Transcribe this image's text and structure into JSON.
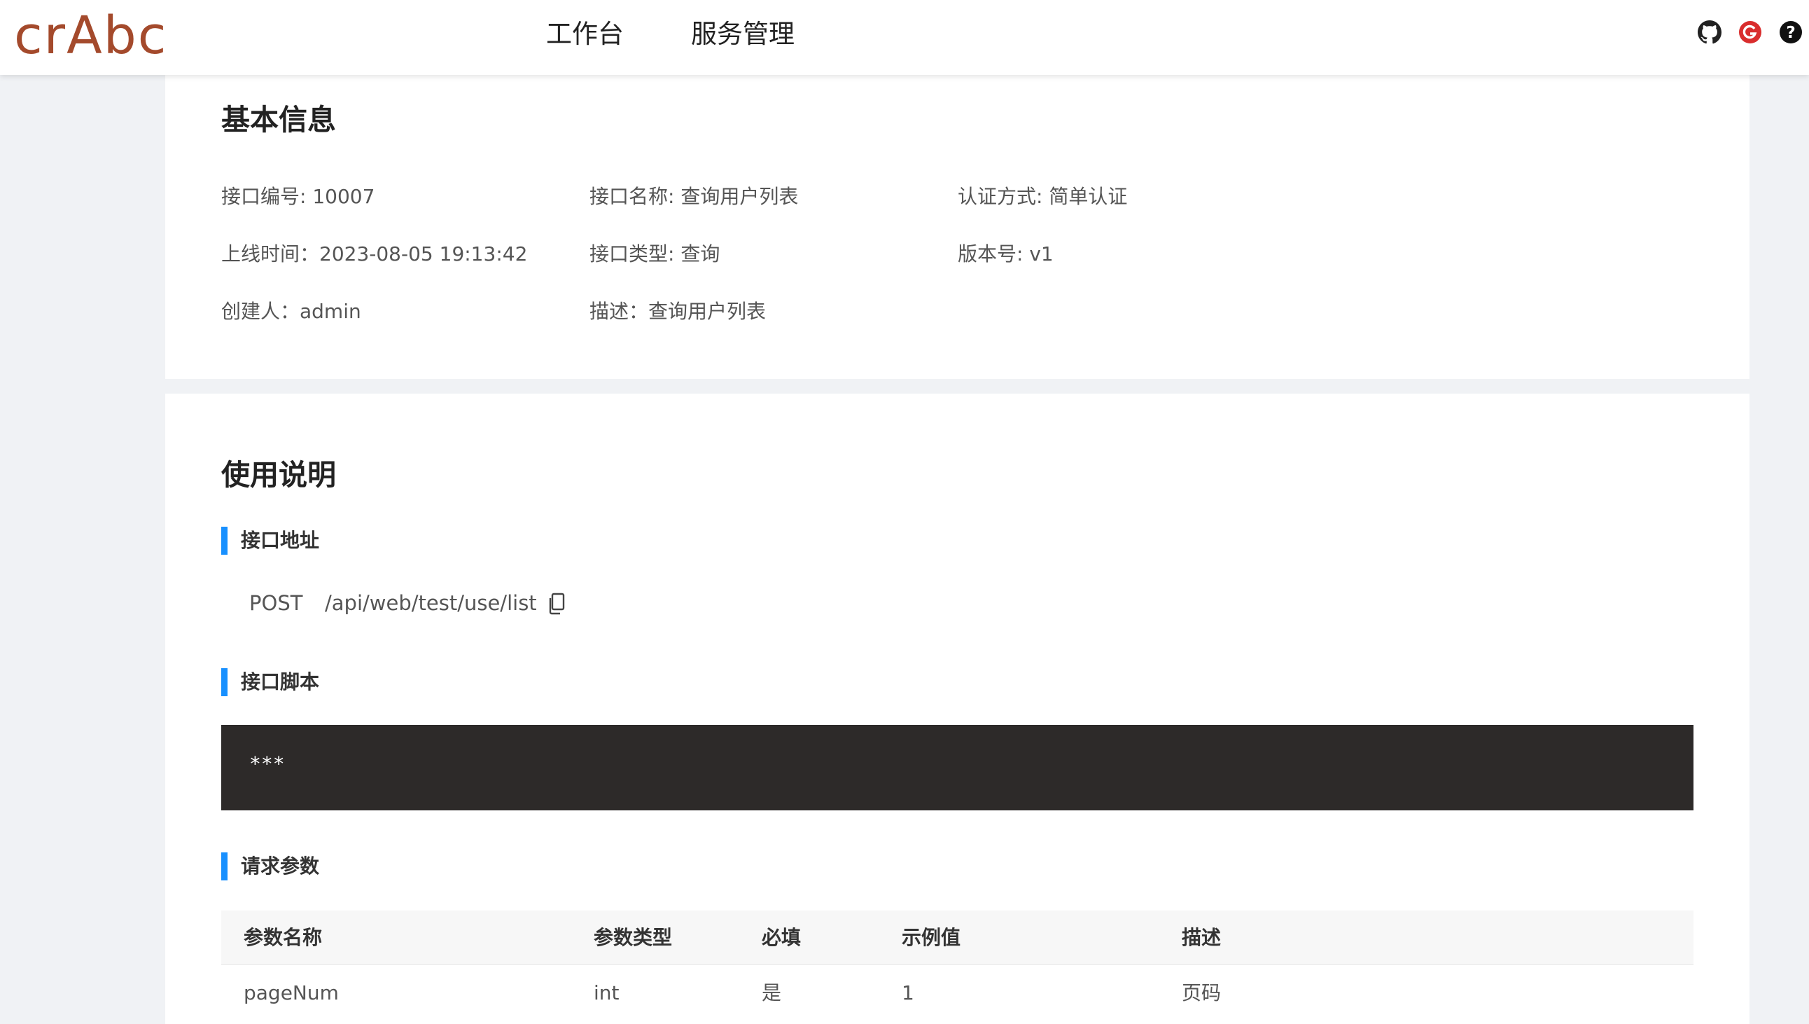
{
  "header": {
    "logo": "crAbc",
    "nav": [
      "工作台",
      "服务管理"
    ],
    "icons": [
      "github-icon",
      "brand-g-icon",
      "help-icon"
    ],
    "brand_color": "#a44a2c"
  },
  "basic_info": {
    "title": "基本信息",
    "api_id": "接口编号: 10007",
    "api_name": "接口名称: 查询用户列表",
    "auth_method": "认证方式: 简单认证",
    "online_time": "上线时间：2023-08-05 19:13:42",
    "api_type": "接口类型: 查询",
    "version": "版本号: v1",
    "creator": "创建人：admin",
    "description": "描述：查询用户列表"
  },
  "usage": {
    "title": "使用说明",
    "address_label": "接口地址",
    "method": "POST",
    "path": "/api/web/test/use/list",
    "script_label": "接口脚本",
    "script_content": "***",
    "params_label": "请求参数",
    "accent_color": "#1890ff",
    "table": {
      "headers": [
        "参数名称",
        "参数类型",
        "必填",
        "示例值",
        "描述"
      ],
      "rows": [
        [
          "pageNum",
          "int",
          "是",
          "1",
          "页码"
        ]
      ]
    }
  }
}
